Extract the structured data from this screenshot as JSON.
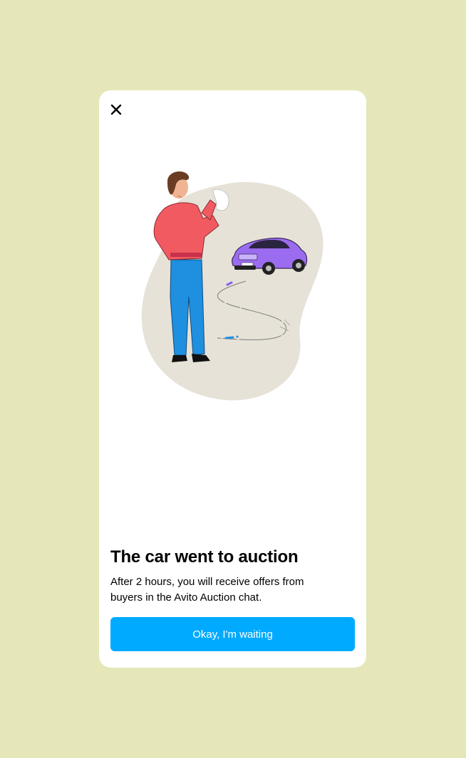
{
  "dialog": {
    "title": "The car went to auction",
    "description": "After 2 hours, you will receive offers from buyers in the Avito Auction chat.",
    "primary_button_label": "Okay, I'm waiting",
    "close_icon": "close-icon",
    "illustration": "person-waving-goodbye-to-car"
  },
  "colors": {
    "background": "#e5e7b8",
    "card": "#ffffff",
    "accent": "#00aaff",
    "blob": "#e6e2d8",
    "car": "#9b6cf0",
    "shirt": "#f25a62",
    "jeans": "#1f8fe0"
  }
}
